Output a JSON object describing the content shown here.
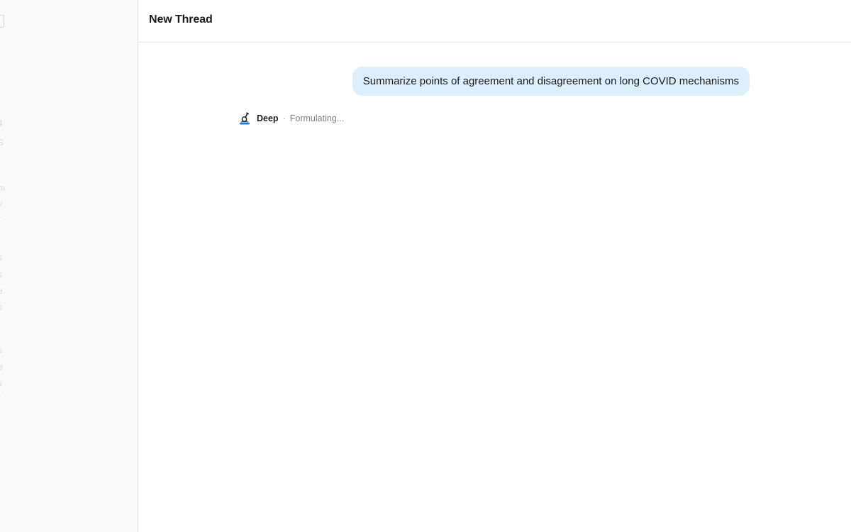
{
  "thread": {
    "title": "New Thread"
  },
  "messages": [
    {
      "role": "user",
      "text": "Summarize points of agreement and disagreement on long COVID mechanisms"
    }
  ],
  "response": {
    "mode_label": "Deep",
    "separator": "·",
    "status": "Formulating..."
  },
  "sidebar": {
    "faded_glyphs": [
      "4",
      "S",
      "m",
      "v",
      "r",
      "s",
      "s",
      "e",
      "s",
      "s",
      "e",
      "s",
      "r"
    ]
  },
  "colors": {
    "user_bubble": "#ddeefd",
    "sidebar_bg": "#f9f9f9",
    "accent_blue": "#1f7fd0"
  },
  "icons": {
    "mode": "microscope-icon"
  }
}
